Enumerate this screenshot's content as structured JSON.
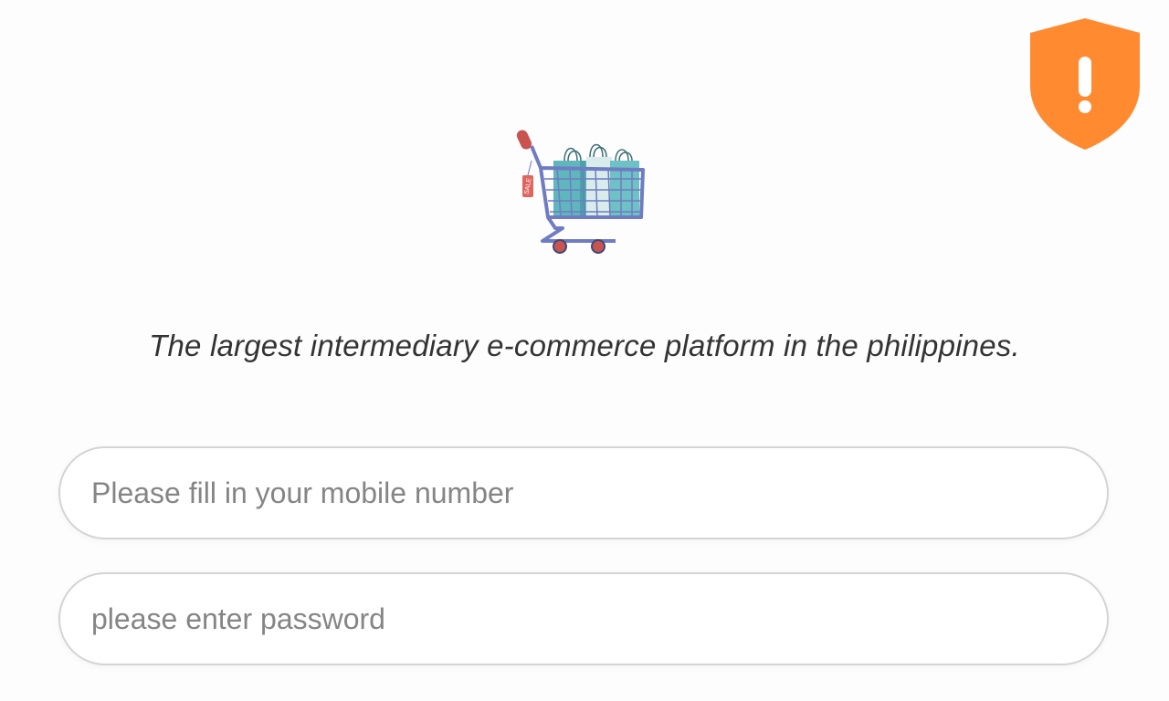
{
  "header": {
    "tagline": "The largest intermediary e-commerce platform in the philippines."
  },
  "logo": {
    "icon": "shopping-cart-icon",
    "tag_text": "SALE"
  },
  "security_badge": {
    "icon": "shield-alert-icon",
    "color": "#ff8a30"
  },
  "login_form": {
    "mobile": {
      "value": "",
      "placeholder": "Please fill in your mobile number"
    },
    "password": {
      "value": "",
      "placeholder": "please enter password"
    }
  }
}
